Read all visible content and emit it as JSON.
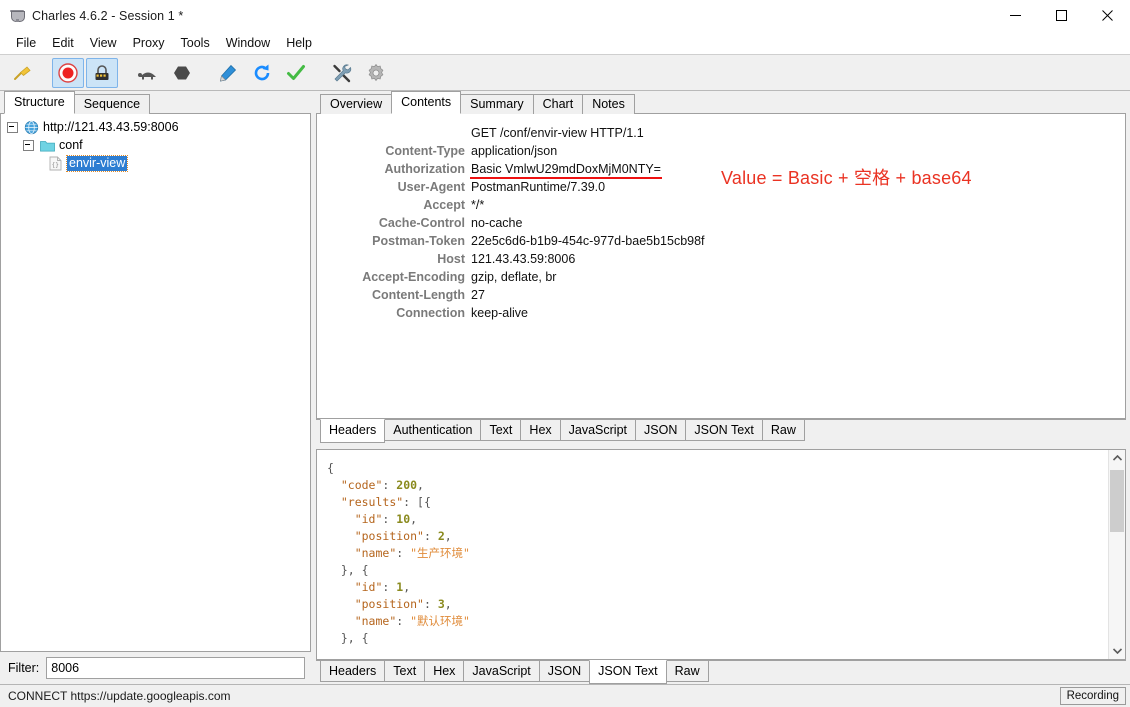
{
  "window": {
    "title": "Charles 4.6.2 - Session 1 *",
    "app_icon": "charles-cup-icon",
    "minimize": "minimize-icon",
    "maximize": "maximize-icon",
    "close": "close-icon"
  },
  "menubar": {
    "items": [
      {
        "label": "File"
      },
      {
        "label": "Edit"
      },
      {
        "label": "View"
      },
      {
        "label": "Proxy"
      },
      {
        "label": "Tools"
      },
      {
        "label": "Window"
      },
      {
        "label": "Help"
      }
    ]
  },
  "toolbar": {
    "buttons": [
      {
        "name": "clear-session-broom-icon",
        "toggled": false
      },
      {
        "name": "record-icon",
        "toggled": true
      },
      {
        "name": "ssl-proxying-icon",
        "toggled": true
      },
      {
        "name": "throttle-turtle-icon",
        "toggled": false
      },
      {
        "name": "breakpoints-icon",
        "toggled": false
      },
      {
        "name": "compose-pen-icon",
        "toggled": false
      },
      {
        "name": "repeat-icon",
        "toggled": false
      },
      {
        "name": "validate-check-icon",
        "toggled": false
      },
      {
        "name": "tools-icon",
        "toggled": false
      },
      {
        "name": "settings-gear-icon",
        "toggled": false
      }
    ]
  },
  "left_pane": {
    "tabs": [
      {
        "label": "Structure",
        "active": true
      },
      {
        "label": "Sequence",
        "active": false
      }
    ],
    "tree": [
      {
        "label": "http://121.43.43.59:8006",
        "level": 1,
        "icon": "globe-icon",
        "expanded": true,
        "selected": false
      },
      {
        "label": "conf",
        "level": 2,
        "icon": "folder-icon",
        "expanded": true,
        "selected": false
      },
      {
        "label": "envir-view",
        "level": 3,
        "icon": "json-file-icon",
        "expanded": false,
        "selected": true
      }
    ],
    "filter": {
      "label": "Filter:",
      "value": "8006",
      "placeholder": ""
    }
  },
  "right_pane": {
    "top_tabs": [
      {
        "label": "Overview",
        "active": false
      },
      {
        "label": "Contents",
        "active": true
      },
      {
        "label": "Summary",
        "active": false
      },
      {
        "label": "Chart",
        "active": false
      },
      {
        "label": "Notes",
        "active": false
      }
    ],
    "request": {
      "request_line": "GET /conf/envir-view HTTP/1.1",
      "headers": [
        {
          "name": "Content-Type",
          "value": "application/json",
          "highlight": false
        },
        {
          "name": "Authorization",
          "value": "Basic VmlwU29mdDoxMjM0NTY=",
          "highlight": true
        },
        {
          "name": "User-Agent",
          "value": "PostmanRuntime/7.39.0",
          "highlight": false
        },
        {
          "name": "Accept",
          "value": "*/*",
          "highlight": false
        },
        {
          "name": "Cache-Control",
          "value": "no-cache",
          "highlight": false
        },
        {
          "name": "Postman-Token",
          "value": "22e5c6d6-b1b9-454c-977d-bae5b15cb98f",
          "highlight": false
        },
        {
          "name": "Host",
          "value": "121.43.43.59:8006",
          "highlight": false
        },
        {
          "name": "Accept-Encoding",
          "value": "gzip, deflate, br",
          "highlight": false
        },
        {
          "name": "Content-Length",
          "value": "27",
          "highlight": false
        },
        {
          "name": "Connection",
          "value": "keep-alive",
          "highlight": false
        }
      ],
      "annotation": {
        "text": "Value =  Basic + 空格 + base64",
        "color": "#ea3323"
      },
      "view_tabs": [
        {
          "label": "Headers",
          "active": true
        },
        {
          "label": "Authentication",
          "active": false
        },
        {
          "label": "Text",
          "active": false
        },
        {
          "label": "Hex",
          "active": false
        },
        {
          "label": "JavaScript",
          "active": false
        },
        {
          "label": "JSON",
          "active": false
        },
        {
          "label": "JSON Text",
          "active": false
        },
        {
          "label": "Raw",
          "active": false
        }
      ]
    },
    "response": {
      "json_lines": [
        [
          {
            "t": "{",
            "c": "punct"
          }
        ],
        [
          {
            "t": "  ",
            "c": "punct"
          },
          {
            "t": "\"code\"",
            "c": "key"
          },
          {
            "t": ": ",
            "c": "punct"
          },
          {
            "t": "200",
            "c": "num"
          },
          {
            "t": ",",
            "c": "punct"
          }
        ],
        [
          {
            "t": "  ",
            "c": "punct"
          },
          {
            "t": "\"results\"",
            "c": "key"
          },
          {
            "t": ": [{",
            "c": "punct"
          }
        ],
        [
          {
            "t": "    ",
            "c": "punct"
          },
          {
            "t": "\"id\"",
            "c": "key"
          },
          {
            "t": ": ",
            "c": "punct"
          },
          {
            "t": "10",
            "c": "num"
          },
          {
            "t": ",",
            "c": "punct"
          }
        ],
        [
          {
            "t": "    ",
            "c": "punct"
          },
          {
            "t": "\"position\"",
            "c": "key"
          },
          {
            "t": ": ",
            "c": "punct"
          },
          {
            "t": "2",
            "c": "num"
          },
          {
            "t": ",",
            "c": "punct"
          }
        ],
        [
          {
            "t": "    ",
            "c": "punct"
          },
          {
            "t": "\"name\"",
            "c": "key"
          },
          {
            "t": ": ",
            "c": "punct"
          },
          {
            "t": "\"生产环境\"",
            "c": "str"
          }
        ],
        [
          {
            "t": "  }, {",
            "c": "punct"
          }
        ],
        [
          {
            "t": "    ",
            "c": "punct"
          },
          {
            "t": "\"id\"",
            "c": "key"
          },
          {
            "t": ": ",
            "c": "punct"
          },
          {
            "t": "1",
            "c": "num"
          },
          {
            "t": ",",
            "c": "punct"
          }
        ],
        [
          {
            "t": "    ",
            "c": "punct"
          },
          {
            "t": "\"position\"",
            "c": "key"
          },
          {
            "t": ": ",
            "c": "punct"
          },
          {
            "t": "3",
            "c": "num"
          },
          {
            "t": ",",
            "c": "punct"
          }
        ],
        [
          {
            "t": "    ",
            "c": "punct"
          },
          {
            "t": "\"name\"",
            "c": "key"
          },
          {
            "t": ": ",
            "c": "punct"
          },
          {
            "t": "\"默认环境\"",
            "c": "str"
          }
        ],
        [
          {
            "t": "  }, {",
            "c": "punct"
          }
        ]
      ],
      "view_tabs": [
        {
          "label": "Headers",
          "active": false
        },
        {
          "label": "Text",
          "active": false
        },
        {
          "label": "Hex",
          "active": false
        },
        {
          "label": "JavaScript",
          "active": false
        },
        {
          "label": "JSON",
          "active": false
        },
        {
          "label": "JSON Text",
          "active": true
        },
        {
          "label": "Raw",
          "active": false
        }
      ],
      "scrollbar": {
        "up_arrow": "chevron-up-icon",
        "down_arrow": "chevron-down-icon"
      }
    }
  },
  "statusbar": {
    "text": "CONNECT https://update.googleapis.com",
    "recording_label": "Recording"
  }
}
